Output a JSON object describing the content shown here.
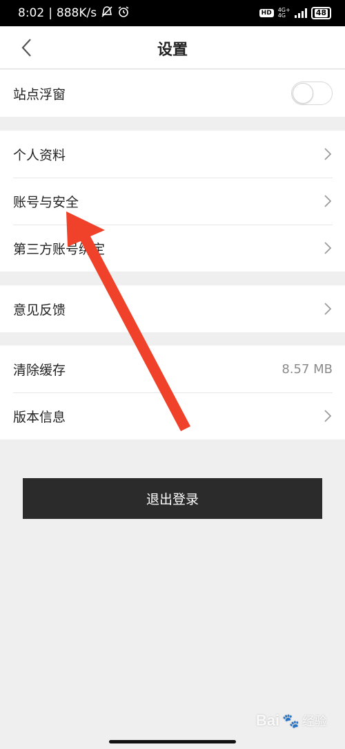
{
  "status_bar": {
    "time": "8:02",
    "network_speed": "888K/s",
    "hd": "HD",
    "net_top": "4G+",
    "net_bottom": "4G",
    "battery": "48"
  },
  "header": {
    "title": "设置"
  },
  "groups": {
    "floating": {
      "label": "站点浮窗",
      "toggle_on": false
    },
    "account": {
      "profile": "个人资料",
      "security": "账号与安全",
      "third_party": "第三方账号绑定"
    },
    "feedback": {
      "label": "意见反馈"
    },
    "misc": {
      "clear_cache": "清除缓存",
      "cache_size": "8.57 MB",
      "version": "版本信息"
    }
  },
  "logout": {
    "label": "退出登录"
  },
  "watermark": {
    "brand": "Bai",
    "suffix": "经验"
  },
  "colors": {
    "background": "#efefef",
    "button": "#2b2b2b",
    "arrow": "#f0422a"
  }
}
